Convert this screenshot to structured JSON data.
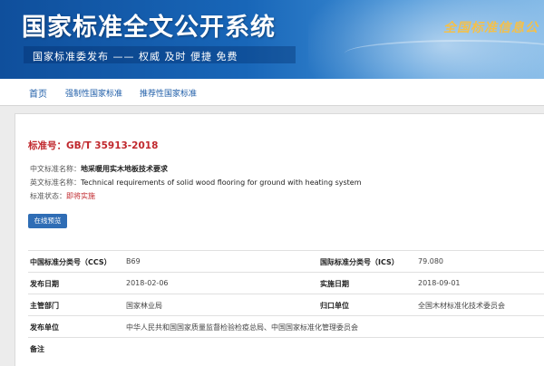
{
  "header": {
    "title": "国家标准全文公开系统",
    "subtitle": "国家标准委发布 —— 权威  及时  便捷  免费",
    "seal_text": "全国标准信息公"
  },
  "nav": {
    "home": "首页",
    "mandatory": "强制性国家标准",
    "recommended": "推荐性国家标准"
  },
  "standard": {
    "number_label": "标准号：",
    "number": "GB/T 35913-2018",
    "cn_name_label": "中文标准名称：",
    "cn_name": "地采暖用实木地板技术要求",
    "en_name_label": "英文标准名称：",
    "en_name": "Technical requirements of solid wood flooring for ground with heating system",
    "status_label": "标准状态：",
    "status": "即将实施",
    "preview_button": "在线预览"
  },
  "details": [
    {
      "l1": "中国标准分类号（CCS）",
      "v1": "B69",
      "l2": "国际标准分类号（ICS）",
      "v2": "79.080"
    },
    {
      "l1": "发布日期",
      "v1": "2018-02-06",
      "l2": "实施日期",
      "v2": "2018-09-01"
    },
    {
      "l1": "主管部门",
      "v1": "国家林业局",
      "l2": "归口单位",
      "v2": "全国木材标准化技术委员会"
    },
    {
      "l1": "发布单位",
      "v1": "中华人民共和国国家质量监督检验检疫总局、中国国家标准化管理委员会",
      "l2": "",
      "v2": ""
    },
    {
      "l1": "备注",
      "v1": "",
      "l2": "",
      "v2": ""
    }
  ],
  "colors": {
    "brand_blue": "#1866b8",
    "accent_red": "#c0282d",
    "button_blue": "#2f6db5"
  }
}
